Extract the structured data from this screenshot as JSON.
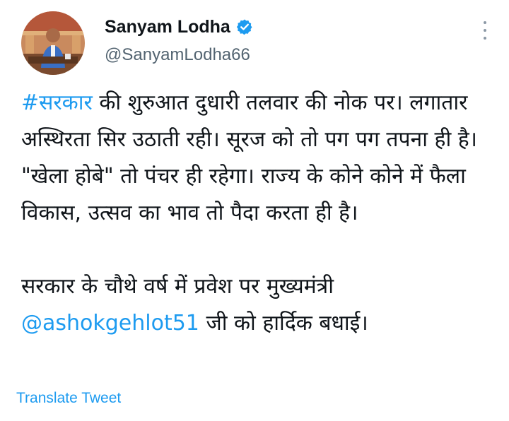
{
  "author": {
    "display_name": "Sanyam Lodha",
    "handle": "@SanyamLodha66",
    "verified": true
  },
  "tweet": {
    "paragraph1": {
      "hashtag": "#सरकार",
      "text": " की शुरुआत दुधारी तलवार की नोक पर। लगातार अस्थिरता सिर उठाती रही। सूरज को तो पग पग तपना ही है। \"खेला होबे\" तो पंचर ही रहेगा। राज्य के कोने कोने में फैला विकास, उत्सव का भाव तो पैदा करता ही है।"
    },
    "paragraph2": {
      "text_before": "सरकार के चौथे वर्ष में प्रवेश पर मुख्यमंत्री ",
      "mention": "@ashokgehlot51",
      "text_after": " जी को हार्दिक बधाई।"
    }
  },
  "actions": {
    "translate_label": "Translate Tweet"
  },
  "icons": {
    "verified": "verified-badge-icon",
    "more": "more-options-icon"
  },
  "colors": {
    "link": "#1d9bf0",
    "text": "#0f1419",
    "secondary": "#536471"
  }
}
